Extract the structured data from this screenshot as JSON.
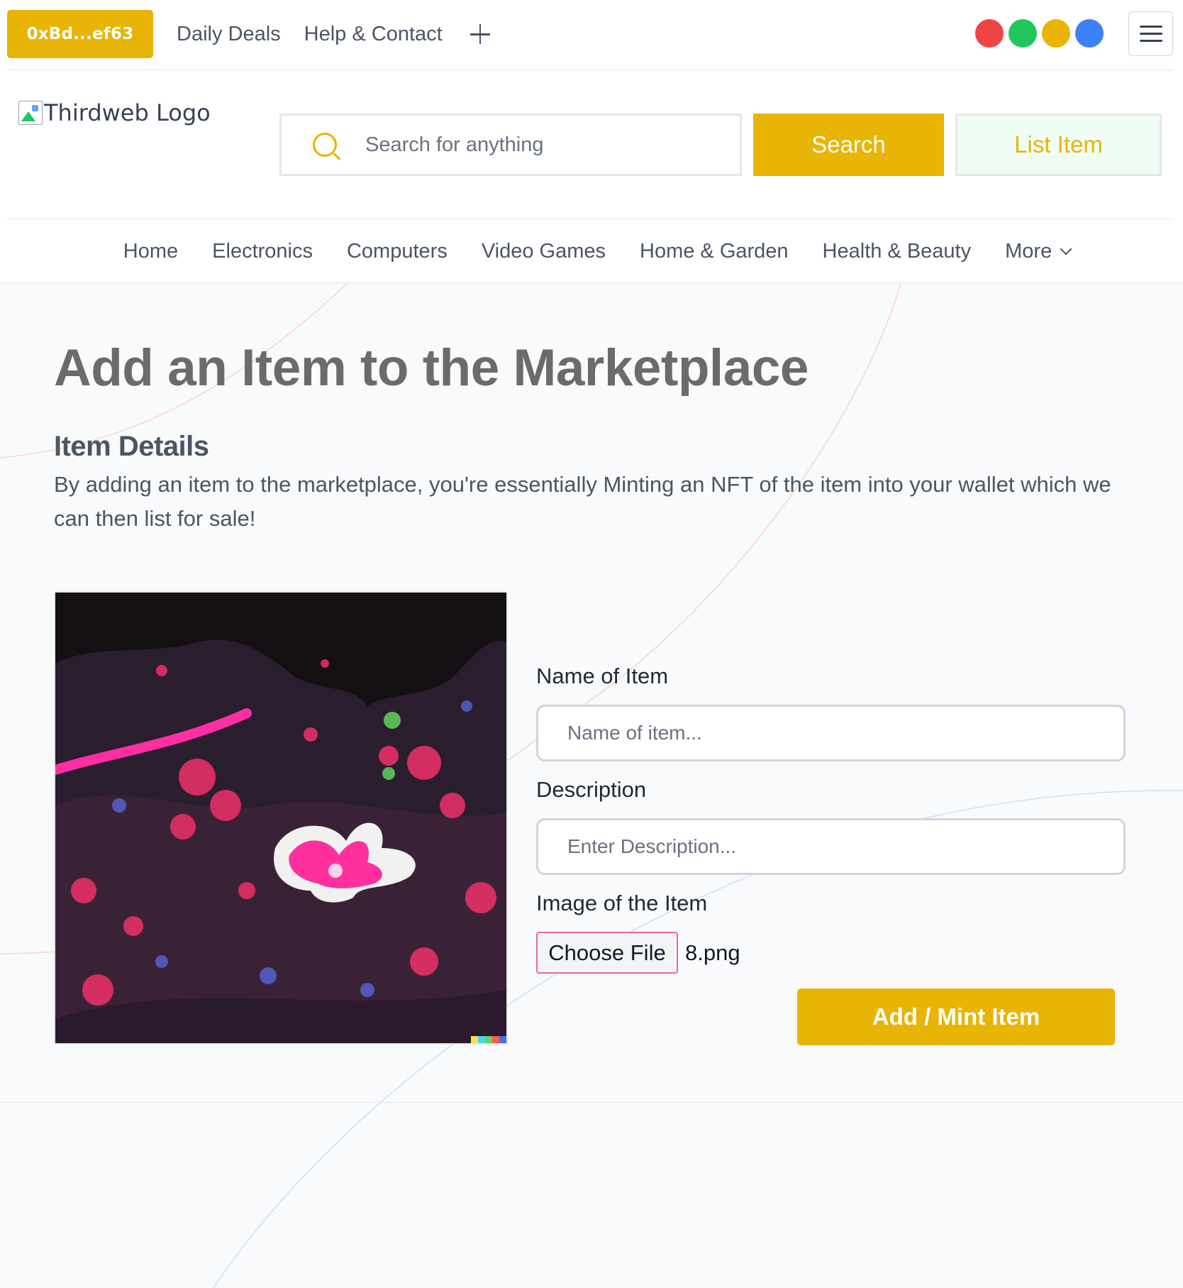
{
  "topbar": {
    "wallet_label": "0xBd...ef63",
    "links": [
      "Daily Deals",
      "Help & Contact"
    ],
    "status_dots": [
      "#ef4444",
      "#22c55e",
      "#e8b405",
      "#3b82f6"
    ]
  },
  "header": {
    "logo_alt": "Thirdweb Logo",
    "search_placeholder": "Search for anything",
    "search_label": "Search",
    "list_item_label": "List Item"
  },
  "categories": [
    "Home",
    "Electronics",
    "Computers",
    "Video Games",
    "Home & Garden",
    "Health & Beauty"
  ],
  "more_label": "More",
  "page": {
    "title": "Add an Item to the Marketplace",
    "section_title": "Item Details",
    "section_description": "By adding an item to the marketplace, you're essentially Minting an NFT of the item into your wallet which we can then list for sale!"
  },
  "form": {
    "name_label": "Name of Item",
    "name_placeholder": "Name of item...",
    "description_label": "Description",
    "description_placeholder": "Enter Description...",
    "image_label": "Image of the Item",
    "choose_file_label": "Choose File",
    "file_name": "8.png",
    "submit_label": "Add / Mint Item"
  },
  "colors": {
    "accent": "#e8b405",
    "list_item_bg": "#f0fdf4",
    "page_bg": "#f9fafb"
  }
}
